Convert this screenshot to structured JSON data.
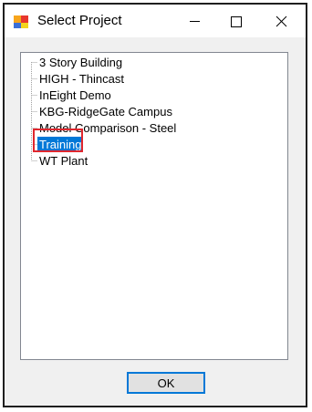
{
  "window": {
    "title": "Select Project"
  },
  "projects": [
    "3 Story Building",
    "HIGH - Thincast",
    "InEight Demo",
    "KBG-RidgeGate Campus",
    "Model Comparison - Steel",
    "Training",
    "WT Plant"
  ],
  "selected_project": "Training",
  "buttons": {
    "ok_label": "OK"
  },
  "colors": {
    "selection": "#0078d7",
    "highlight_border": "#e0272e"
  }
}
